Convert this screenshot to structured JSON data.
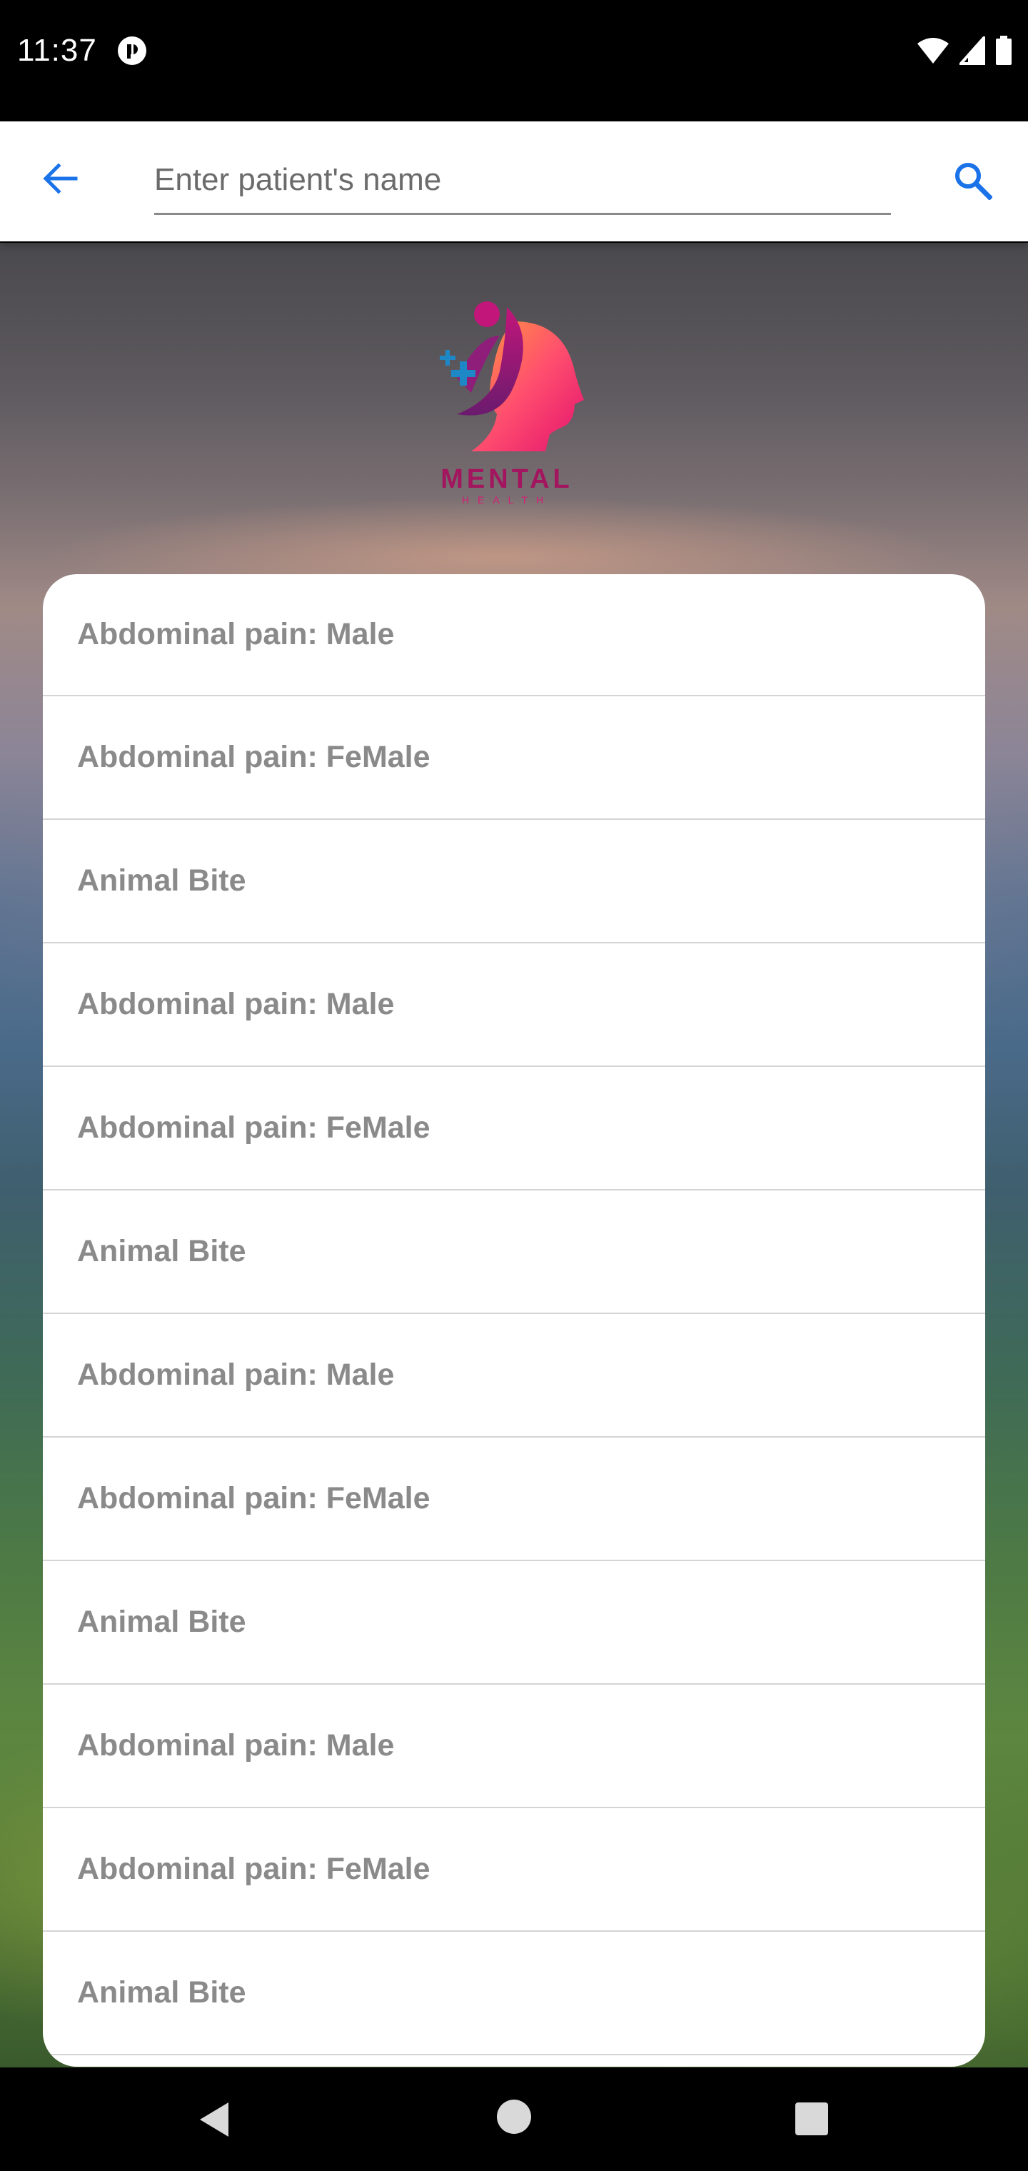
{
  "status_bar": {
    "time": "11:37",
    "icons": [
      "app-notification-icon",
      "wifi-icon",
      "cellular-signal-icon",
      "battery-icon"
    ]
  },
  "app_bar": {
    "back_icon": "arrow-left-icon",
    "search_placeholder": "Enter patient's name",
    "search_value": "",
    "search_icon": "search-icon",
    "accent_color": "#1a73e8"
  },
  "logo": {
    "title": "MENTAL",
    "subtitle": "HEALTH"
  },
  "list": {
    "items": [
      {
        "label": "Abdominal pain: Male"
      },
      {
        "label": "Abdominal pain: FeMale"
      },
      {
        "label": "Animal Bite"
      },
      {
        "label": "Abdominal pain: Male"
      },
      {
        "label": "Abdominal pain: FeMale"
      },
      {
        "label": "Animal Bite"
      },
      {
        "label": "Abdominal pain: Male"
      },
      {
        "label": "Abdominal pain: FeMale"
      },
      {
        "label": "Animal Bite"
      },
      {
        "label": "Abdominal pain: Male"
      },
      {
        "label": "Abdominal pain: FeMale"
      },
      {
        "label": "Animal Bite"
      }
    ]
  },
  "nav_bar": {
    "icons": [
      "nav-back-icon",
      "nav-home-icon",
      "nav-recents-icon"
    ]
  }
}
